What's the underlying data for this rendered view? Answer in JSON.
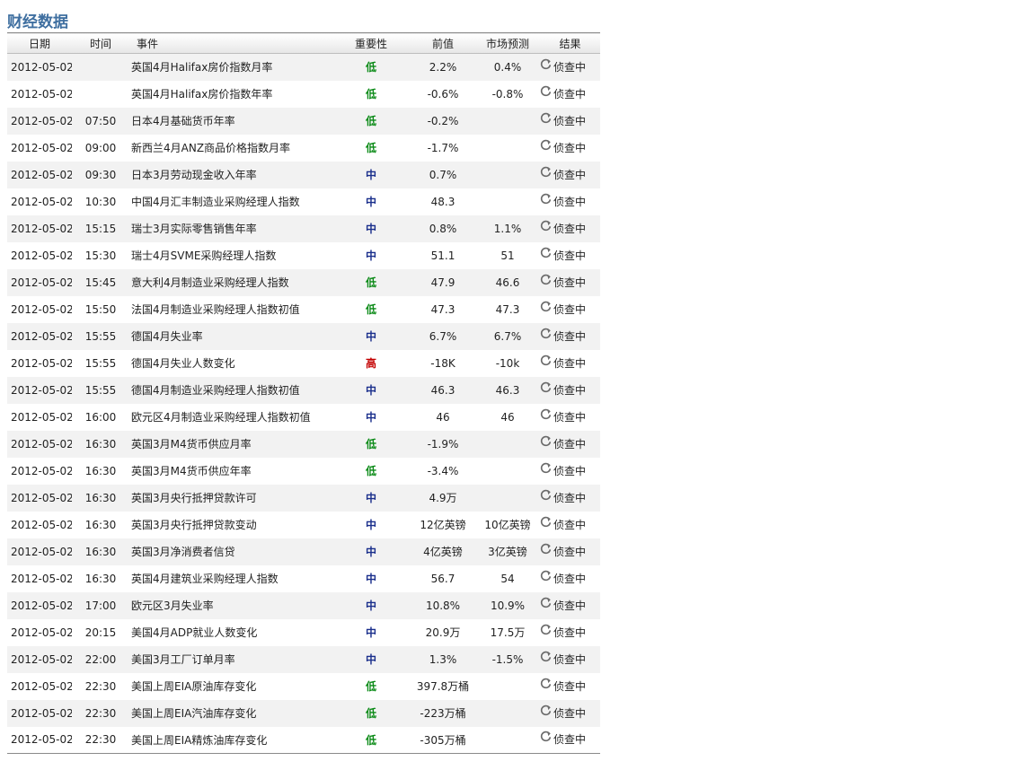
{
  "title": "财经数据",
  "columns": {
    "date": "日期",
    "time": "时间",
    "event": "事件",
    "importance": "重要性",
    "previous": "前值",
    "forecast": "市场预测",
    "result": "结果"
  },
  "importance_colors": {
    "低": "#0a8a16",
    "中": "#1a2f8c",
    "高": "#c40000"
  },
  "rows": [
    {
      "date": "2012-05-02",
      "time": "",
      "event": "英国4月Halifax房价指数月率",
      "importance": "低",
      "previous": "2.2%",
      "forecast": "0.4%",
      "result": "侦查中"
    },
    {
      "date": "2012-05-02",
      "time": "",
      "event": "英国4月Halifax房价指数年率",
      "importance": "低",
      "previous": "-0.6%",
      "forecast": "-0.8%",
      "result": "侦查中"
    },
    {
      "date": "2012-05-02",
      "time": "07:50",
      "event": "日本4月基础货币年率",
      "importance": "低",
      "previous": "-0.2%",
      "forecast": "",
      "result": "侦查中"
    },
    {
      "date": "2012-05-02",
      "time": "09:00",
      "event": "新西兰4月ANZ商品价格指数月率",
      "importance": "低",
      "previous": "-1.7%",
      "forecast": "",
      "result": "侦查中"
    },
    {
      "date": "2012-05-02",
      "time": "09:30",
      "event": "日本3月劳动现金收入年率",
      "importance": "中",
      "previous": "0.7%",
      "forecast": "",
      "result": "侦查中"
    },
    {
      "date": "2012-05-02",
      "time": "10:30",
      "event": "中国4月汇丰制造业采购经理人指数",
      "importance": "中",
      "previous": "48.3",
      "forecast": "",
      "result": "侦查中"
    },
    {
      "date": "2012-05-02",
      "time": "15:15",
      "event": "瑞士3月实际零售销售年率",
      "importance": "中",
      "previous": "0.8%",
      "forecast": "1.1%",
      "result": "侦查中"
    },
    {
      "date": "2012-05-02",
      "time": "15:30",
      "event": "瑞士4月SVME采购经理人指数",
      "importance": "中",
      "previous": "51.1",
      "forecast": "51",
      "result": "侦查中"
    },
    {
      "date": "2012-05-02",
      "time": "15:45",
      "event": "意大利4月制造业采购经理人指数",
      "importance": "低",
      "previous": "47.9",
      "forecast": "46.6",
      "result": "侦查中"
    },
    {
      "date": "2012-05-02",
      "time": "15:50",
      "event": "法国4月制造业采购经理人指数初值",
      "importance": "低",
      "previous": "47.3",
      "forecast": "47.3",
      "result": "侦查中"
    },
    {
      "date": "2012-05-02",
      "time": "15:55",
      "event": "德国4月失业率",
      "importance": "中",
      "previous": "6.7%",
      "forecast": "6.7%",
      "result": "侦查中"
    },
    {
      "date": "2012-05-02",
      "time": "15:55",
      "event": "德国4月失业人数变化",
      "importance": "高",
      "previous": "-18K",
      "forecast": "-10k",
      "result": "侦查中"
    },
    {
      "date": "2012-05-02",
      "time": "15:55",
      "event": "德国4月制造业采购经理人指数初值",
      "importance": "中",
      "previous": "46.3",
      "forecast": "46.3",
      "result": "侦查中"
    },
    {
      "date": "2012-05-02",
      "time": "16:00",
      "event": "欧元区4月制造业采购经理人指数初值",
      "importance": "中",
      "previous": "46",
      "forecast": "46",
      "result": "侦查中"
    },
    {
      "date": "2012-05-02",
      "time": "16:30",
      "event": "英国3月M4货币供应月率",
      "importance": "低",
      "previous": "-1.9%",
      "forecast": "",
      "result": "侦查中"
    },
    {
      "date": "2012-05-02",
      "time": "16:30",
      "event": "英国3月M4货币供应年率",
      "importance": "低",
      "previous": "-3.4%",
      "forecast": "",
      "result": "侦查中"
    },
    {
      "date": "2012-05-02",
      "time": "16:30",
      "event": "英国3月央行抵押贷款许可",
      "importance": "中",
      "previous": "4.9万",
      "forecast": "",
      "result": "侦查中"
    },
    {
      "date": "2012-05-02",
      "time": "16:30",
      "event": "英国3月央行抵押贷款变动",
      "importance": "中",
      "previous": "12亿英镑",
      "forecast": "10亿英镑",
      "result": "侦查中"
    },
    {
      "date": "2012-05-02",
      "time": "16:30",
      "event": "英国3月净消费者信贷",
      "importance": "中",
      "previous": "4亿英镑",
      "forecast": "3亿英镑",
      "result": "侦查中"
    },
    {
      "date": "2012-05-02",
      "time": "16:30",
      "event": "英国4月建筑业采购经理人指数",
      "importance": "中",
      "previous": "56.7",
      "forecast": "54",
      "result": "侦查中"
    },
    {
      "date": "2012-05-02",
      "time": "17:00",
      "event": "欧元区3月失业率",
      "importance": "中",
      "previous": "10.8%",
      "forecast": "10.9%",
      "result": "侦查中"
    },
    {
      "date": "2012-05-02",
      "time": "20:15",
      "event": "美国4月ADP就业人数变化",
      "importance": "中",
      "previous": "20.9万",
      "forecast": "17.5万",
      "result": "侦查中"
    },
    {
      "date": "2012-05-02",
      "time": "22:00",
      "event": "美国3月工厂订单月率",
      "importance": "中",
      "previous": "1.3%",
      "forecast": "-1.5%",
      "result": "侦查中"
    },
    {
      "date": "2012-05-02",
      "time": "22:30",
      "event": "美国上周EIA原油库存变化",
      "importance": "低",
      "previous": "397.8万桶",
      "forecast": "",
      "result": "侦查中"
    },
    {
      "date": "2012-05-02",
      "time": "22:30",
      "event": "美国上周EIA汽油库存变化",
      "importance": "低",
      "previous": "-223万桶",
      "forecast": "",
      "result": "侦查中"
    },
    {
      "date": "2012-05-02",
      "time": "22:30",
      "event": "美国上周EIA精炼油库存变化",
      "importance": "低",
      "previous": "-305万桶",
      "forecast": "",
      "result": "侦查中"
    }
  ]
}
